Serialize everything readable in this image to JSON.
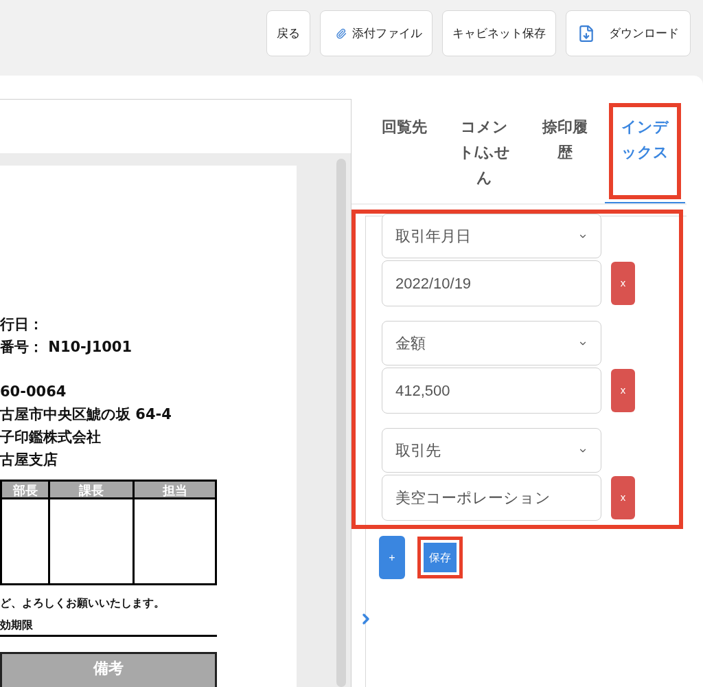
{
  "toolbar": {
    "buttons": [
      {
        "label": "戻る",
        "kind": "plain"
      },
      {
        "label": "添付ファイル",
        "kind": "attach"
      },
      {
        "label": "キャビネット保存",
        "kind": "plain"
      },
      {
        "label": "ダウンロード",
        "kind": "download"
      }
    ]
  },
  "document": {
    "lines": [
      {
        "text": "行日："
      },
      {
        "text": "番号： N10-J1001"
      },
      {
        "text": "60-0064"
      },
      {
        "text": "古屋市中央区鯱の坂 64-4"
      },
      {
        "text": "子印鑑株式会社"
      },
      {
        "text": "古屋支店"
      }
    ],
    "approval_columns": [
      "部長",
      "課長",
      "担当"
    ],
    "note": "ど、よろしくお願いいたします。",
    "deadline_label": "効期限",
    "remarks_header": "備考"
  },
  "tabs": [
    {
      "label": "回覧先",
      "selected": false,
      "highlighted": false
    },
    {
      "label": "コメント/ふせん",
      "selected": false,
      "highlighted": false
    },
    {
      "label": "捺印履歴",
      "selected": false,
      "highlighted": false
    },
    {
      "label": "インデックス",
      "selected": true,
      "highlighted": true
    }
  ],
  "index_panel": {
    "highlighted": true,
    "fields": [
      {
        "field": "取引年月日",
        "value": "2022/10/19",
        "remove": "x"
      },
      {
        "field": "金額",
        "value": "412,500",
        "remove": "x"
      },
      {
        "field": "取引先",
        "value": "美空コーポレーション",
        "remove": "x"
      }
    ],
    "add_button": "+",
    "save_button": {
      "label": "保存",
      "highlighted": true
    }
  }
}
